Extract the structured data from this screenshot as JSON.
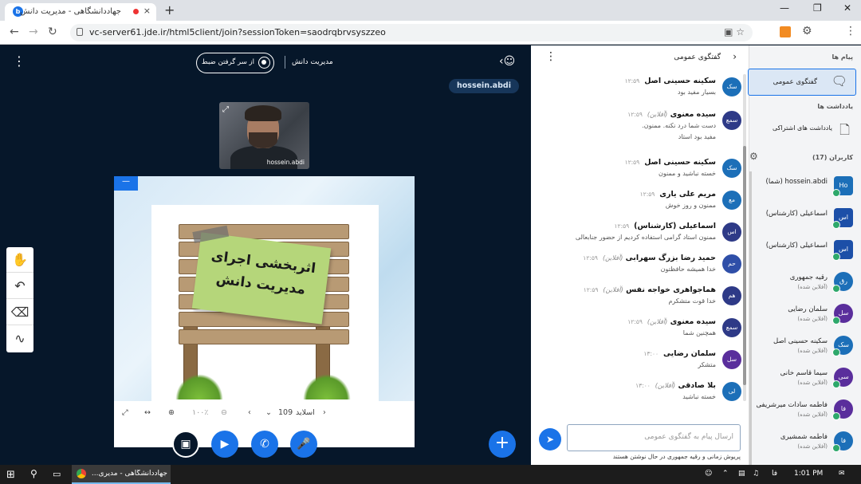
{
  "browser": {
    "tab_title": "جهاددانشگاهی - مدیریت دانش",
    "url": "vc-server61.jde.ir/html5client/join?sessionToken=saodrqbrvsyszzeo",
    "new_tab": "+",
    "close_tab": "×"
  },
  "meeting": {
    "name": "مدیریت دانش",
    "record_label": "از سر گرفتن ضبط",
    "presenter_tag": "hossein.abdi",
    "webcam_name": "hossein.abdi"
  },
  "slide": {
    "line1": "اثربخشی اجرای",
    "line2": "مدیریت دانش",
    "label": "اسلاید",
    "number": "109",
    "zoom": "۱۰۰٪"
  },
  "chat": {
    "header": "گفتگوی عمومی",
    "input_placeholder": "ارسال پیام به گفتگوی عمومی",
    "typing": "پریوش زمانی و رقیه جمهوری در حال نوشتن هستند",
    "messages": [
      {
        "initials": "سک",
        "color": "#1c6fb8",
        "name": "سکینه حسینی اصل",
        "status": "",
        "time": "۱۲:۵۹",
        "text": "بسیار مفید بود",
        "text2": ""
      },
      {
        "initials": "سمع",
        "color": "#2e3a87",
        "name": "سیده معنوی",
        "status": "(آفلاین)",
        "time": "۱۲:۵۹",
        "text": "دست شما درد نکنه. ممنون.",
        "text2": "مفید بود استاد"
      },
      {
        "initials": "سک",
        "color": "#1c6fb8",
        "name": "سکینه حسینی اصل",
        "status": "",
        "time": "۱۲:۵۹",
        "text": "خسته نباشید و ممنون",
        "text2": ""
      },
      {
        "initials": "مع",
        "color": "#1c6fb8",
        "name": "مریم علی یاری",
        "status": "",
        "time": "۱۲:۵۹",
        "text": "ممنون و روز خوش",
        "text2": ""
      },
      {
        "initials": "اس",
        "color": "#2e3a87",
        "name": "اسماعیلی (کارشناس)",
        "status": "",
        "time": "۱۲:۵۹",
        "text": "ممنون استاد گرامی استفاده کردیم از حضور جنابعالی",
        "text2": ""
      },
      {
        "initials": "حم",
        "color": "#2f4fa8",
        "name": "حمید رضا بزرگ سهرابی",
        "status": "(آفلاین)",
        "time": "۱۲:۵۹",
        "text": "خدا همیشه حافظتون",
        "text2": ""
      },
      {
        "initials": "هم",
        "color": "#2e3a87",
        "name": "هماجواهری خواجه نفس",
        "status": "(آفلاین)",
        "time": "۱۲:۵۹",
        "text": "خدا قوت متشکرم",
        "text2": ""
      },
      {
        "initials": "سمع",
        "color": "#2e3a87",
        "name": "سیده معنوی",
        "status": "(آفلاین)",
        "time": "۱۲:۵۹",
        "text": "همچنین شما",
        "text2": ""
      },
      {
        "initials": "سل",
        "color": "#5a2e9c",
        "name": "سلمان رضایی",
        "status": "",
        "time": "۱۳:۰۰",
        "text": "متشکر",
        "text2": ""
      },
      {
        "initials": "لی",
        "color": "#1c6fb8",
        "name": "بلا صادقی",
        "status": "(آفلاین)",
        "time": "۱۳:۰۰",
        "text": "خسته نباشید",
        "text2": ""
      }
    ]
  },
  "users_panel": {
    "messages_label": "پیام ها",
    "public_chat": "گفتگوی عمومی",
    "notes_label": "یادداشت ها",
    "shared_notes": "یادداشت های اشتراکی",
    "users_label": "کاربران (17)",
    "users": [
      {
        "initials": "Ho",
        "color": "#1c6fb8",
        "name": "hossein.abdi (شما)",
        "status": "",
        "square": true
      },
      {
        "initials": "اس",
        "color": "#1c4fa8",
        "name": "اسماعیلی (کارشناس)",
        "status": "",
        "square": true
      },
      {
        "initials": "اس",
        "color": "#1c4fa8",
        "name": "اسماعیلی (کارشناس)",
        "status": "",
        "square": true
      },
      {
        "initials": "رق",
        "color": "#1c6fb8",
        "name": "رقیه جمهوری",
        "status": "(آفلاین شده)",
        "square": false
      },
      {
        "initials": "سل",
        "color": "#5a2e9c",
        "name": "سلمان رضایی",
        "status": "(آفلاین شده)",
        "square": false
      },
      {
        "initials": "سک",
        "color": "#1c6fb8",
        "name": "سکینه حسینی اصل",
        "status": "(آفلاین شده)",
        "square": false
      },
      {
        "initials": "سی",
        "color": "#5a2e9c",
        "name": "سیما قاسم خانی",
        "status": "(آفلاین شده)",
        "square": false
      },
      {
        "initials": "فا",
        "color": "#5a2e9c",
        "name": "فاطمه سادات میرشریفی",
        "status": "(آفلاین شده)",
        "square": false
      },
      {
        "initials": "فا",
        "color": "#1c6fb8",
        "name": "فاطمه شمشیری",
        "status": "(آفلاین شده)",
        "square": false
      }
    ]
  },
  "taskbar": {
    "app_title": "جهاددانشگاهی - مدیری...",
    "lang": "فا",
    "time": "1:01 PM"
  }
}
